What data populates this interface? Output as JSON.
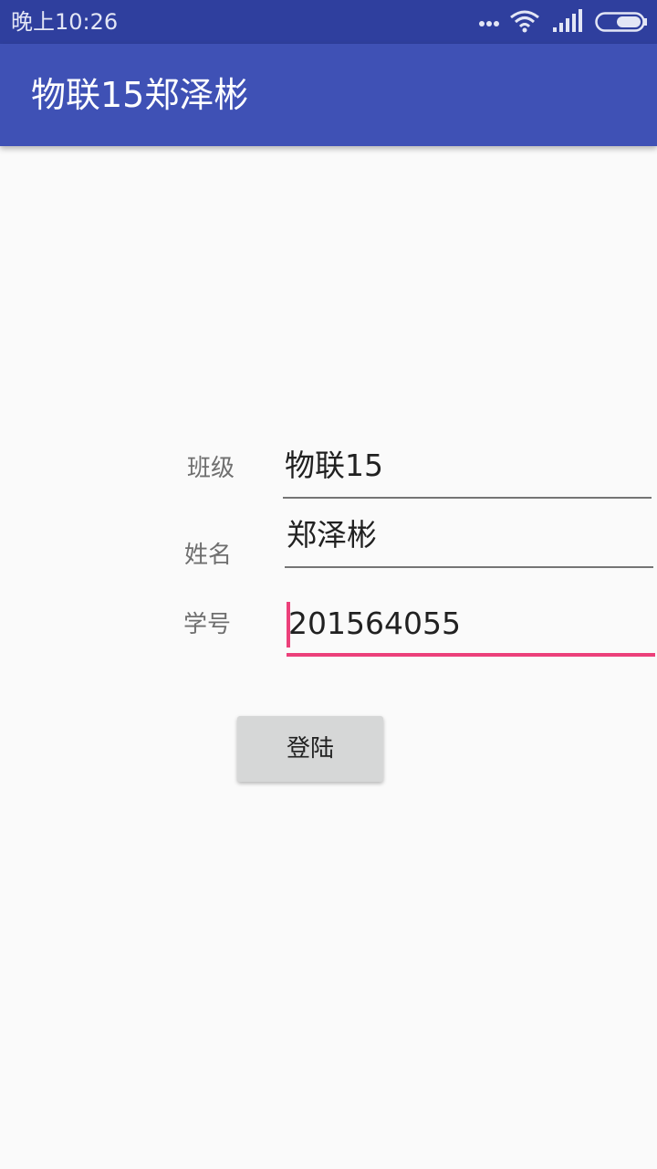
{
  "status_bar": {
    "time": "晚上10:26",
    "icons": [
      "more-dots-icon",
      "wifi-icon",
      "signal-icon",
      "battery-icon"
    ]
  },
  "app_bar": {
    "title": "物联15郑泽彬",
    "background": "#3f51b5"
  },
  "form": {
    "class_label": "班级",
    "class_value": "物联15",
    "name_label": "姓名",
    "name_value": "郑泽彬",
    "id_label": "学号",
    "id_value": "201564055",
    "accent": "#ec407a"
  },
  "login_button": {
    "label": "登陆"
  }
}
